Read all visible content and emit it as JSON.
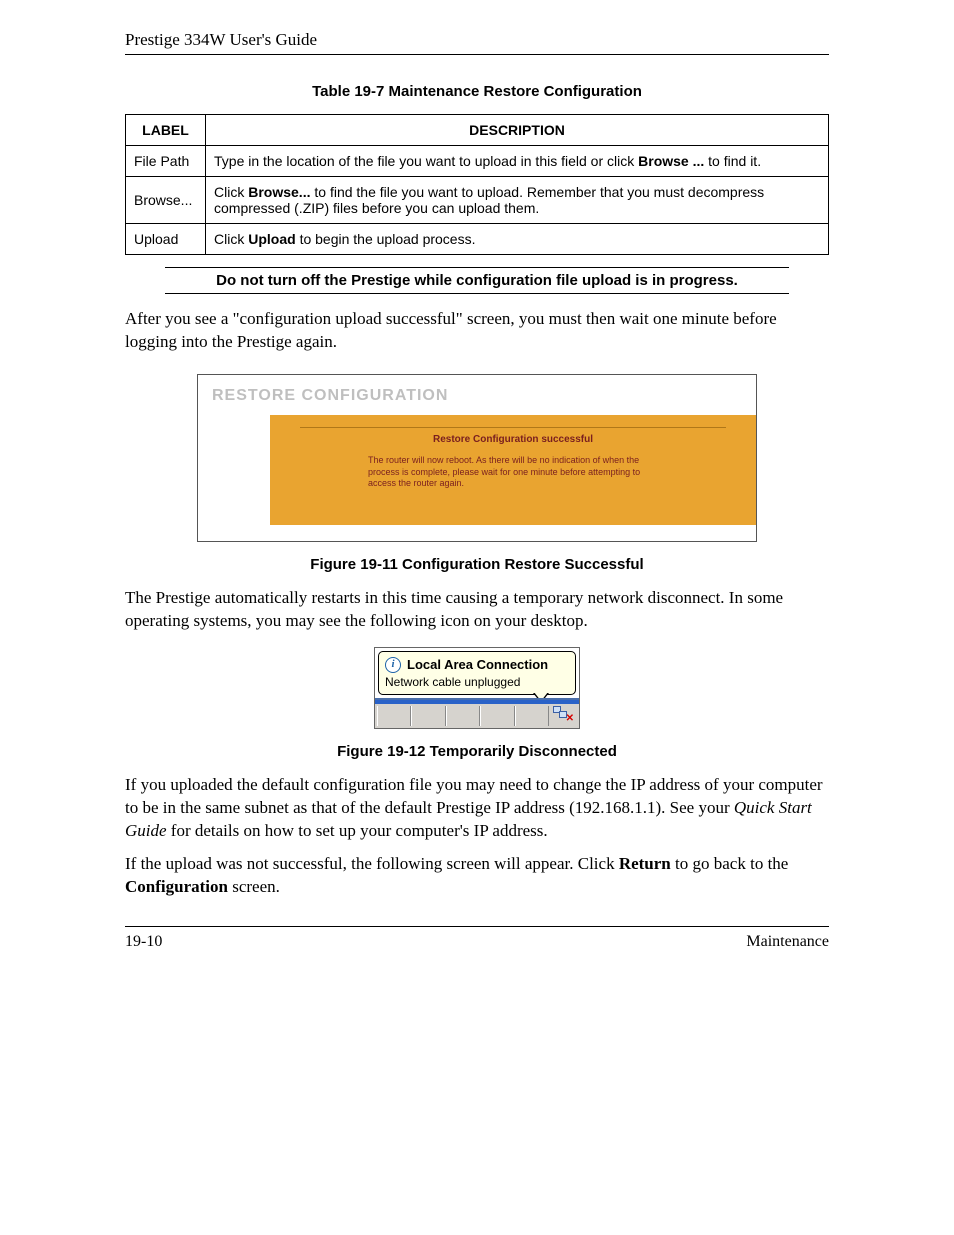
{
  "header": {
    "title": "Prestige 334W User's Guide"
  },
  "table": {
    "caption": "Table 19-7 Maintenance Restore Configuration",
    "columns": {
      "label": "LABEL",
      "description": "DESCRIPTION"
    },
    "rows": [
      {
        "label": "File Path",
        "desc_pre": "Type in the location of the file you want to upload in this field or click ",
        "desc_bold": "Browse ...",
        "desc_post": " to find it."
      },
      {
        "label": "Browse...",
        "desc_pre": "Click ",
        "desc_bold": "Browse...",
        "desc_post": " to find the file you want to upload. Remember that you must decompress compressed (.ZIP) files before you can upload them."
      },
      {
        "label": "Upload",
        "desc_pre": "Click ",
        "desc_bold": "Upload",
        "desc_post": " to begin the upload process."
      }
    ]
  },
  "warning": "Do not turn off the Prestige while configuration file upload is in progress.",
  "para1": "After you see a \"configuration upload successful\" screen, you must then wait one minute before logging into the Prestige again.",
  "fig1": {
    "panel_title": "RESTORE CONFIGURATION",
    "msg_title": "Restore Configuration successful",
    "msg_body": "The router will now reboot. As there will be no indication of when the process is complete, please wait for one minute before attempting to access the router again.",
    "caption": "Figure 19-11 Configuration Restore Successful"
  },
  "para2": "The Prestige automatically restarts in this time causing a temporary network disconnect. In some operating systems, you may see the following icon on your desktop.",
  "fig2": {
    "balloon_title": "Local Area Connection",
    "balloon_body": "Network cable unplugged",
    "caption": "Figure 19-12 Temporarily Disconnected"
  },
  "para3": {
    "pre": "If you uploaded the default configuration file you may need to change the IP address of your computer to be in the same subnet as that of the default Prestige IP address (192.168.1.1). See your ",
    "italic": "Quick Start Guide",
    "post": " for details on how to set up your computer's IP address."
  },
  "para4": {
    "pre": "If the upload was not successful, the following screen will appear. Click ",
    "bold1": "Return",
    "mid": " to go back to the ",
    "bold2": "Configuration",
    "post": " screen."
  },
  "footer": {
    "left": "19-10",
    "right": "Maintenance"
  }
}
